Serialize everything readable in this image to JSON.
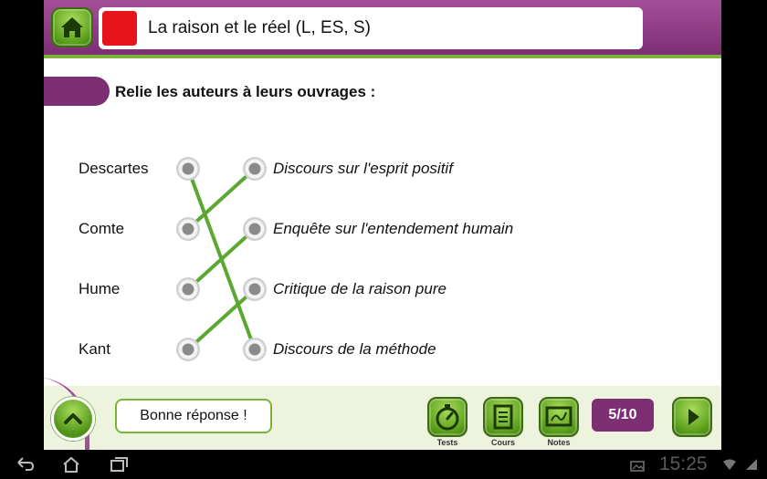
{
  "header": {
    "title": "La raison et le réel (L, ES, S)",
    "accent_color": "#e8141c"
  },
  "instruction": "Relie les auteurs à leurs ouvrages :",
  "exercise": {
    "authors": [
      "Descartes",
      "Comte",
      "Hume",
      "Kant"
    ],
    "works": [
      "Discours sur l'esprit positif",
      "Enquête sur l'entendement humain",
      "Critique de la raison pure",
      "Discours de la méthode"
    ],
    "links": [
      [
        0,
        3
      ],
      [
        1,
        0
      ],
      [
        2,
        1
      ],
      [
        3,
        2
      ]
    ]
  },
  "footer": {
    "feedback": "Bonne réponse !",
    "tools": [
      {
        "label": "Tests",
        "icon": "stopwatch-icon"
      },
      {
        "label": "Cours",
        "icon": "notepad-icon"
      },
      {
        "label": "Notes",
        "icon": "chalkboard-icon"
      }
    ],
    "progress": "5/10"
  },
  "status_bar": {
    "time": "15:25"
  },
  "colors": {
    "purple": "#7d2f74",
    "green": "#5b9f1c",
    "link_line": "#5aa832"
  }
}
